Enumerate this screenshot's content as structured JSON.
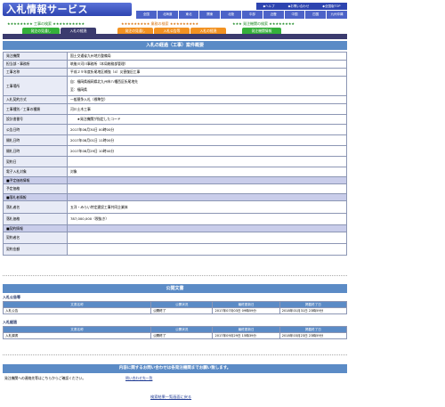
{
  "header": {
    "logo_text": "入札情報サービス",
    "top_links": [
      "◆ヘルプ",
      "◆お問い合わせ",
      "◆全国版TOP"
    ],
    "regions": [
      "全国",
      "北海道",
      "東北",
      "関東",
      "北陸",
      "中部",
      "近畿",
      "中国",
      "四国",
      "九州沖縄"
    ],
    "categories": {
      "construction": "★★★★★★★★  工事の検索  ★★★★★★★★★★",
      "service": "★★★★★★★★★  業務の検索  ★★★★★★★★★",
      "issuer": "★★★  発注機関の検索  ★★★★★★★★"
    },
    "tabs": [
      "発注の見通し",
      "入札の経過",
      "入札公告等",
      "入札の経過",
      "発注機関情報"
    ]
  },
  "main": {
    "title": "入札の経過（工事）案件概要",
    "rows": [
      {
        "label": "発注機関",
        "value": "国土交通省九州地方整備局"
      },
      {
        "label": "担当部・事務所",
        "value": "筑後川河川事務所（本局総務部管理）"
      },
      {
        "label": "工事名称",
        "value": "平成２９年度折尾地区補強（4）災害復旧工事"
      },
      {
        "label": "工事場所",
        "value": "自：福岡県福岡県北九州市八幡西区折尾地先",
        "value2": "至：福岡県"
      },
      {
        "label": "入札契約方式",
        "value": "一般競争入札（標準型）"
      },
      {
        "label": "工事種別／工事の種類",
        "value": "河川土木工事"
      },
      {
        "label": "設計書番号",
        "value": "　　★発注機関が指定したコード"
      },
      {
        "label": "公告日時",
        "value": "2017年06月30日 00時00分"
      },
      {
        "label": "開札日時",
        "value": "2017年08月01日 11時00分"
      },
      {
        "label": "開札日時",
        "value": "2017年08月29日 10時40分"
      },
      {
        "label": "契約日",
        "value": ""
      },
      {
        "label": "電子入札対象",
        "value": "対象"
      }
    ],
    "group_estimate": "■予定価格情報",
    "estimate_label": "予定価格",
    "group_winner": "■落札者情報",
    "winner_rows": [
      {
        "label": "落札者名",
        "value": "五洋・みらい特定建設工事共同企業体"
      },
      {
        "label": "落札価格",
        "value": "787,000,000（税抜き）"
      }
    ],
    "group_contract": "■契約情報",
    "contract_rows": [
      {
        "label": "契約者名",
        "value": ""
      },
      {
        "label": "契約金額",
        "value": ""
      }
    ]
  },
  "documents": {
    "title": "公開文書",
    "sections": [
      {
        "heading": "入札公告等",
        "columns": [
          "文書名称",
          "公開状況",
          "最終更新日",
          "掲載終了日"
        ],
        "rows": [
          [
            "入札公告",
            "公開終了",
            "2017年07月03日 09時59分",
            "2018年01月31日 23時59分"
          ]
        ]
      },
      {
        "heading": "入札経過",
        "columns": [
          "文書名称",
          "公開状況",
          "最終更新日",
          "掲載終了日"
        ],
        "rows": [
          [
            "入札調書",
            "公開終了",
            "2017年09月29日 15時39分",
            "2018年03月23日 23時59分"
          ]
        ]
      }
    ]
  },
  "contact": {
    "band": "内容に関するお問い合わせは各発注機関までお願い致します。",
    "label": "発注機関への連絡先等はこちらからご確認ください。",
    "link": "問い合わせ先一覧"
  },
  "footer": {
    "back_link": "検索結果一覧画面に戻る"
  },
  "colors": {
    "brand": "#2d44b0",
    "section_header": "#5b8bc6",
    "tab_green": "#35b03a",
    "tab_orange": "#f29222"
  }
}
